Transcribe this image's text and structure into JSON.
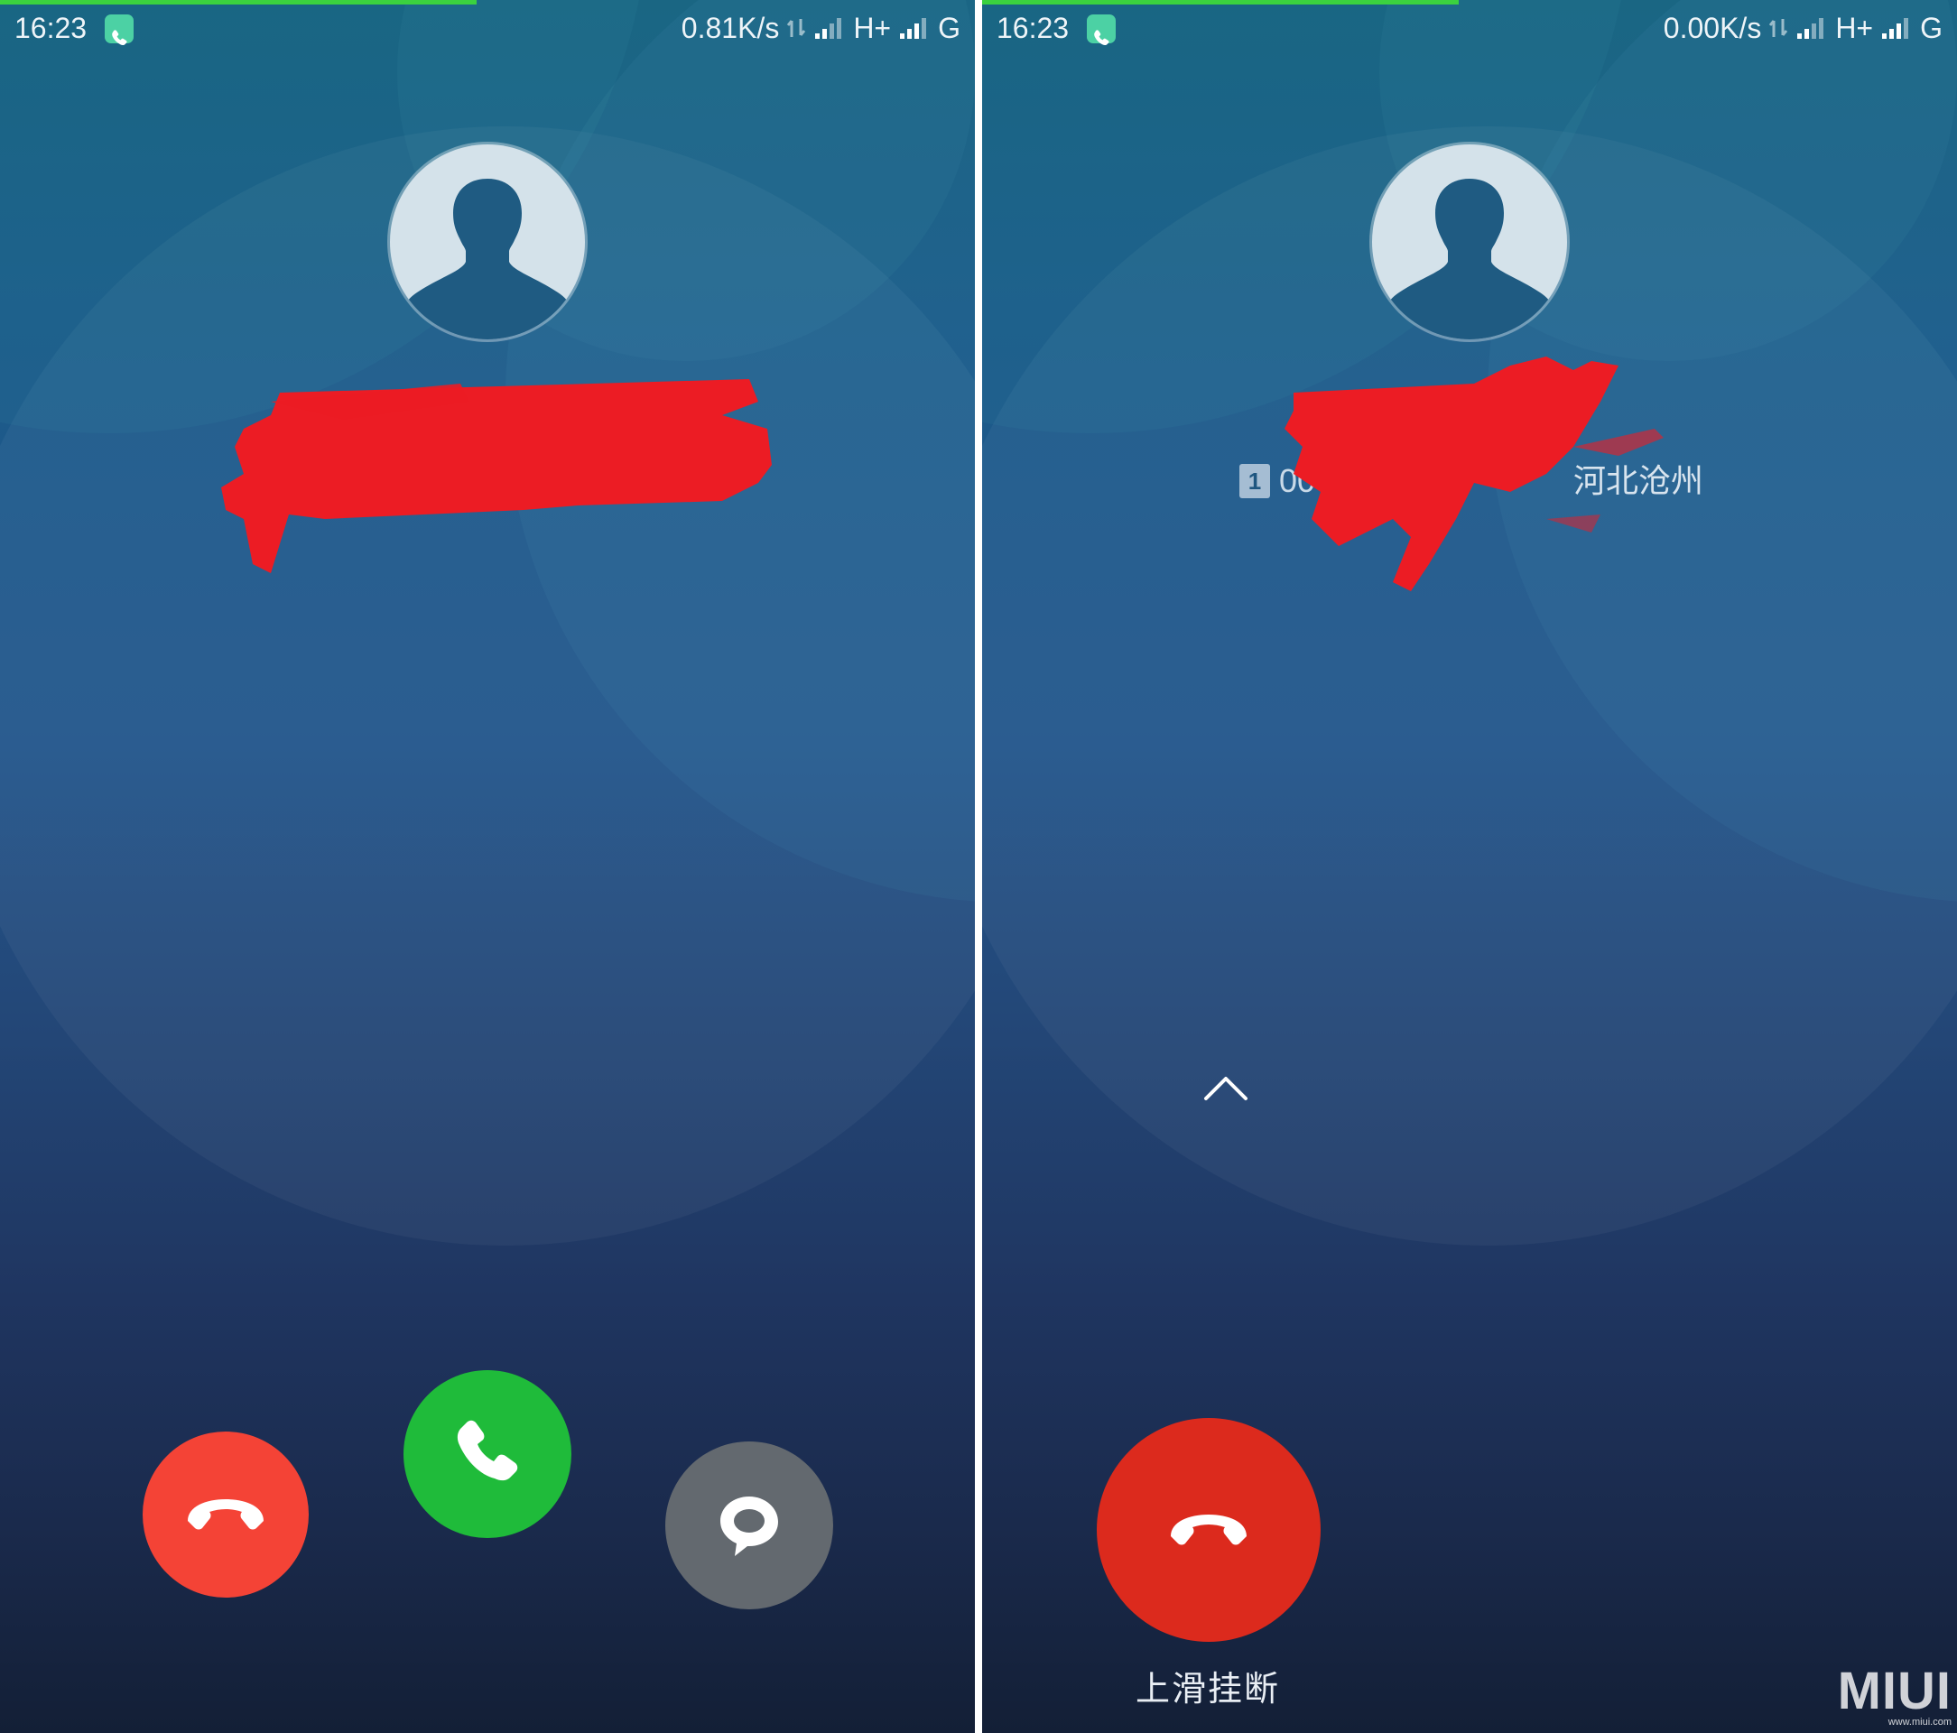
{
  "left_screen": {
    "status_bar": {
      "time": "16:23",
      "net_speed": "0.81K/s",
      "network_type": "H+",
      "second_network": "G"
    },
    "progress": 0.49,
    "caller": {
      "name_redacted": true
    },
    "actions": {
      "decline_icon": "hang-up-icon",
      "answer_icon": "phone-icon",
      "message_icon": "chat-bubble-icon"
    }
  },
  "right_screen": {
    "status_bar": {
      "time": "16:23",
      "net_speed": "0.00K/s",
      "network_type": "H+",
      "second_network": "G"
    },
    "progress": 0.49,
    "caller": {
      "sim_slot": "1",
      "number_partial": "00",
      "location": "河北沧州"
    },
    "swipe_hint": "上滑挂断",
    "hangup_icon": "hang-up-icon"
  },
  "watermark": {
    "brand": "MIUI",
    "url": "www.miui.com"
  },
  "colors": {
    "decline": "#f44336",
    "answer": "#1fbb3a",
    "message": "#63696f",
    "hangup_large": "#dc2a1d",
    "progress": "#3bd23f",
    "redaction": "#ec1c24"
  }
}
